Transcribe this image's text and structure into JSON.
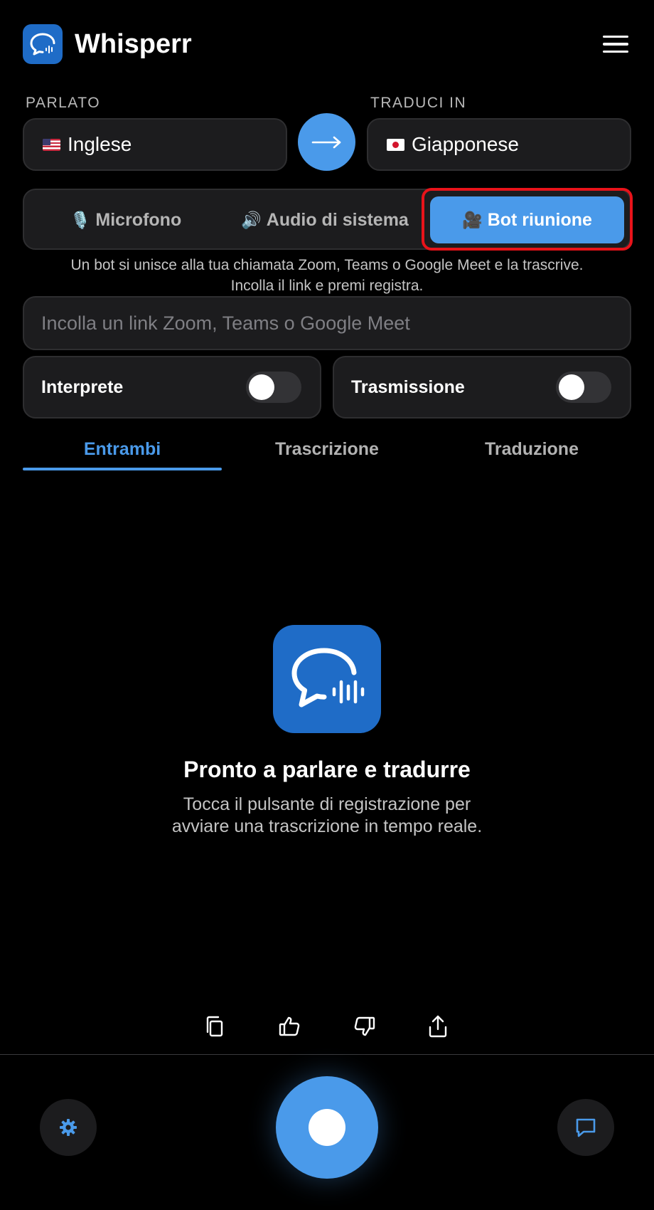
{
  "app": {
    "title": "Whisperr"
  },
  "colors": {
    "accent": "#4a9aea",
    "logo_bg": "#1f6cc7",
    "highlight": "#e8131a",
    "surface": "#1c1c1e"
  },
  "languages": {
    "spoken_label": "PARLATO",
    "spoken_value": "Inglese",
    "spoken_flag": "us-flag-icon",
    "target_label": "TRADUCI IN",
    "target_value": "Giapponese",
    "target_flag": "japan-flag-icon"
  },
  "source_modes": {
    "items": [
      {
        "icon": "🎙️",
        "label": "Microfono"
      },
      {
        "icon": "🔊",
        "label": "Audio di sistema"
      },
      {
        "icon": "🎥",
        "label": "Bot riunione"
      }
    ],
    "selected": "Bot riunione"
  },
  "help_text_line1": "Un bot si unisce alla tua chiamata Zoom, Teams o Google Meet e la trascrive.",
  "help_text_line2": "Incolla il link e premi registra.",
  "meeting_link": {
    "value": "",
    "placeholder": "Incolla un link Zoom, Teams o Google Meet"
  },
  "toggles": [
    {
      "label": "Interprete",
      "on": false
    },
    {
      "label": "Trasmissione",
      "on": false
    }
  ],
  "tabs": {
    "items": [
      "Entrambi",
      "Trascrizione",
      "Traduzione"
    ],
    "selected": "Entrambi"
  },
  "empty_state": {
    "title": "Pronto a parlare e tradurre",
    "subtitle_line1": "Tocca il pulsante di registrazione per",
    "subtitle_line2": "avviare una trascrizione in tempo reale."
  },
  "actions": [
    "copy-icon",
    "thumbs-up-icon",
    "thumbs-down-icon",
    "share-icon"
  ],
  "bottom_bar": {
    "left": "gear-icon",
    "center": "record-button",
    "right": "chat-icon"
  }
}
